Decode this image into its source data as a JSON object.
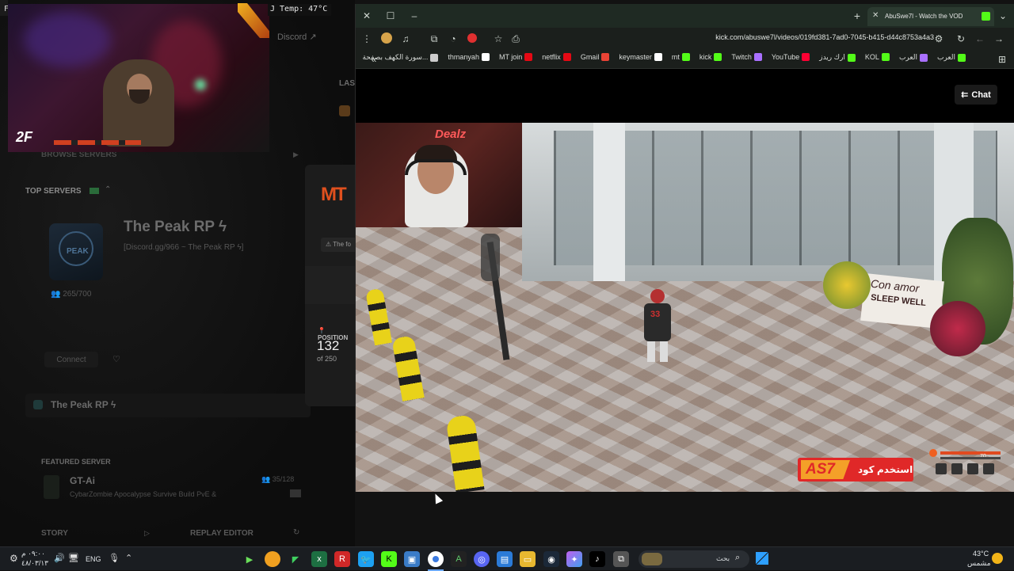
{
  "overlay": {
    "temp_text": "J Temp: 47°C",
    "corner_letter": "F"
  },
  "bg_app": {
    "discord_link": "Discord",
    "browse_servers": "BROWSE SERVERS",
    "top_servers": "TOP SERVERS",
    "server_name": "The Peak RP ϟ",
    "server_desc": "[Discord.gg/966 ~ The Peak RP ϟ]",
    "server_count": "265/700",
    "connect_label": "Connect",
    "recent_server": "The Peak RP ϟ",
    "featured_label": "FEATURED SERVER",
    "featured_name": "GT-Ai",
    "featured_desc": "CybarZombie Apocalypse Survive Build PvE &",
    "featured_count": "35/128",
    "story_label": "STORY",
    "replay_label": "REPLAY EDITOR",
    "last_label": "LAS",
    "side_logo": "MT",
    "side_notice": "The fo",
    "position_label": "POSITION",
    "position_value": "132",
    "position_of": "of 250"
  },
  "browser": {
    "tab_title": "AbuSwe7l - Watch the VOD",
    "url": "kick.com/abuswe7l/videos/019fd381-7ad0-7045-b415-d44c8753a4a3",
    "bookmarks": [
      {
        "label": "العرب",
        "color": "#53fc18"
      },
      {
        "label": "العرب",
        "color": "#a970ff"
      },
      {
        "label": "KOL",
        "color": "#53fc18"
      },
      {
        "label": "ارك ريدز",
        "color": "#53fc18"
      },
      {
        "label": "YouTube",
        "color": "#ff0033"
      },
      {
        "label": "Twitch",
        "color": "#a970ff"
      },
      {
        "label": "kick",
        "color": "#53fc18"
      },
      {
        "label": "mt",
        "color": "#53fc18"
      },
      {
        "label": "keymaster",
        "color": "#ffffff"
      },
      {
        "label": "Gmail",
        "color": "#ea4335"
      },
      {
        "label": "netflix",
        "color": "#e50914"
      },
      {
        "label": "MT join",
        "color": "#e50914"
      },
      {
        "label": "thmanyah",
        "color": "#ffffff"
      },
      {
        "label": "سورة الكهف بصفحة...",
        "color": "#cccccc"
      }
    ],
    "chat_button": "Chat"
  },
  "video": {
    "promo_text": "استخدم كود",
    "promo_code": "AS7",
    "jersey_number": "33",
    "sign_text_1": "Con amor",
    "sign_text_2": "SLEEP WELL",
    "neon_text": "Dealz",
    "hud_value": "70"
  },
  "taskbar": {
    "time": "٠٩:٠٠ م",
    "date": "٤٨/٠٣/١٣",
    "lang": "ENG",
    "search_placeholder": "بحث",
    "weather_temp": "43°C",
    "weather_desc": "مشمس"
  }
}
